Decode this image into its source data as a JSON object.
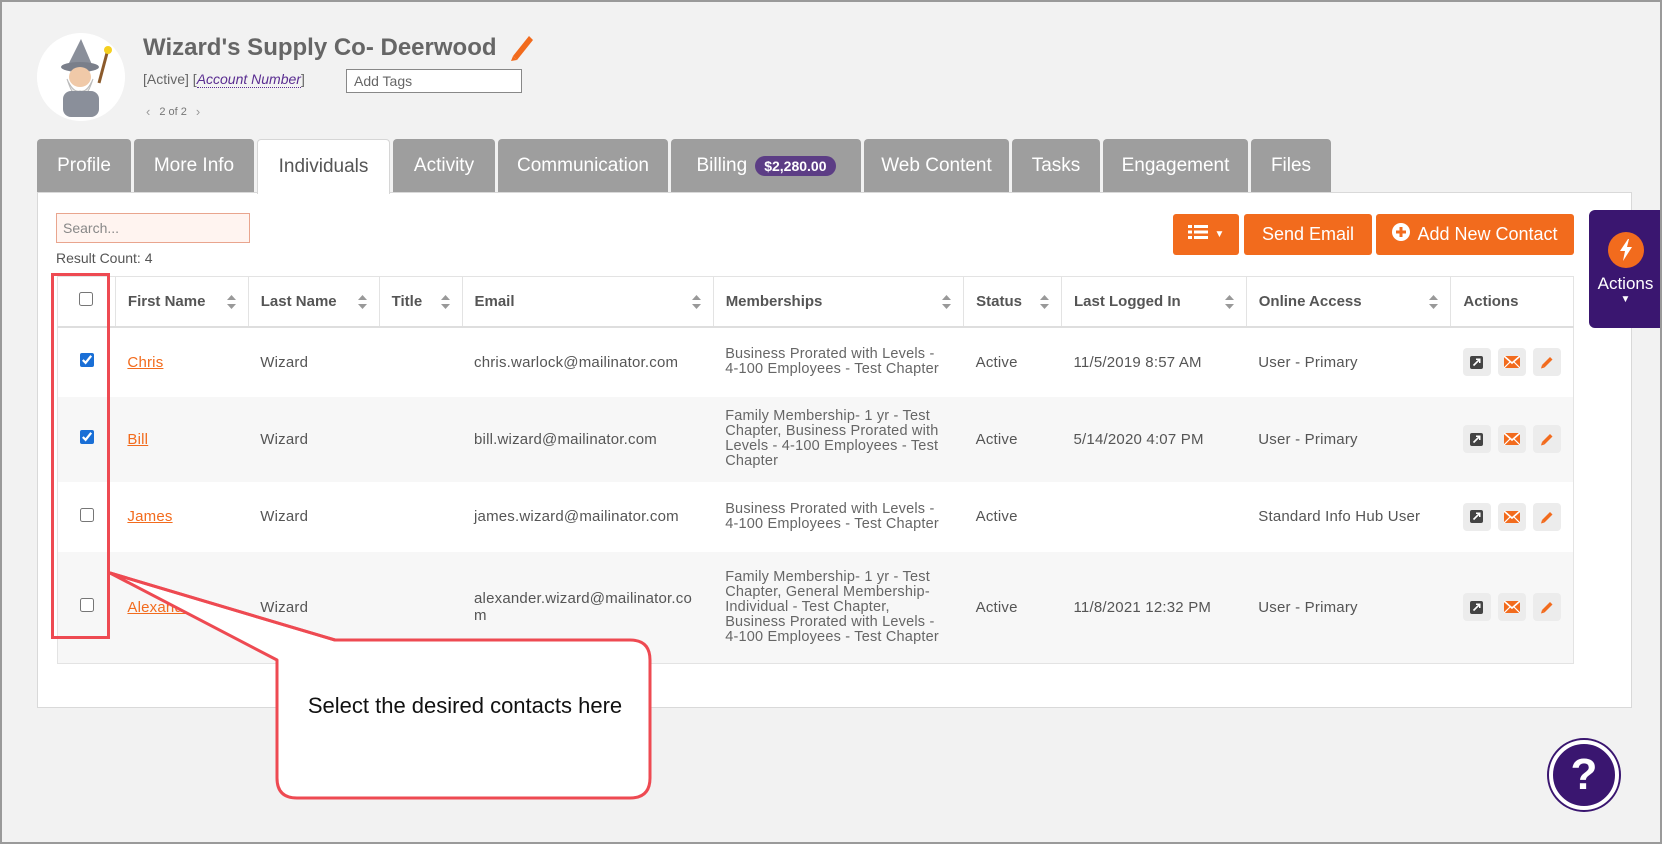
{
  "header": {
    "org_name": "Wizard's Supply Co- Deerwood",
    "status": "[Active]",
    "account_link": "Account Number",
    "tags_placeholder": "Add Tags",
    "pager": "2 of 2"
  },
  "tabs": [
    {
      "label": "Profile"
    },
    {
      "label": "More Info"
    },
    {
      "label": "Individuals"
    },
    {
      "label": "Activity"
    },
    {
      "label": "Communication"
    },
    {
      "label": "Billing",
      "badge": "$2,280.00"
    },
    {
      "label": "Web Content"
    },
    {
      "label": "Tasks"
    },
    {
      "label": "Engagement"
    },
    {
      "label": "Files"
    }
  ],
  "search": {
    "placeholder": "Search..."
  },
  "result_count": "Result Count: 4",
  "toolbar": {
    "send_email": "Send Email",
    "add_contact": "Add New Contact"
  },
  "side_actions": {
    "label": "Actions"
  },
  "table": {
    "headers": {
      "first_name": "First Name",
      "last_name": "Last Name",
      "title": "Title",
      "email": "Email",
      "memberships": "Memberships",
      "status": "Status",
      "last_logged_in": "Last Logged In",
      "online_access": "Online Access",
      "actions": "Actions"
    },
    "rows": [
      {
        "checked": true,
        "first": "Chris",
        "last": "Wizard",
        "title": "",
        "email": "chris.warlock@mailinator.com",
        "memberships": "Business Prorated with Levels - 4-100 Employees - Test Chapter",
        "status": "Active",
        "last_login": "11/5/2019 8:57 AM",
        "access": "User - Primary"
      },
      {
        "checked": true,
        "first": "Bill",
        "last": "Wizard",
        "title": "",
        "email": "bill.wizard@mailinator.com",
        "memberships": "Family Membership- 1 yr - Test Chapter, Business Prorated with Levels - 4-100 Employees - Test Chapter",
        "status": "Active",
        "last_login": "5/14/2020 4:07 PM",
        "access": "User - Primary"
      },
      {
        "checked": false,
        "first": "James",
        "last": "Wizard",
        "title": "",
        "email": "james.wizard@mailinator.com",
        "memberships": "Business Prorated with Levels - 4-100 Employees - Test Chapter",
        "status": "Active",
        "last_login": "",
        "access": "Standard Info Hub User"
      },
      {
        "checked": false,
        "first": "Alexander",
        "last": "Wizard",
        "title": "",
        "email": "alexander.wizard@mailinator.com",
        "memberships": "Family Membership- 1 yr - Test Chapter, General Membership- Individual - Test Chapter, Business Prorated with Levels - 4-100 Employees - Test Chapter",
        "status": "Active",
        "last_login": "11/8/2021 12:32 PM",
        "access": "User - Primary"
      }
    ]
  },
  "callout": {
    "text": "Select the desired contacts here"
  },
  "help": {
    "label": "?"
  },
  "colors": {
    "accent": "#f26b1d",
    "brand_purple": "#3a1670",
    "highlight_red": "#ee4a52"
  }
}
